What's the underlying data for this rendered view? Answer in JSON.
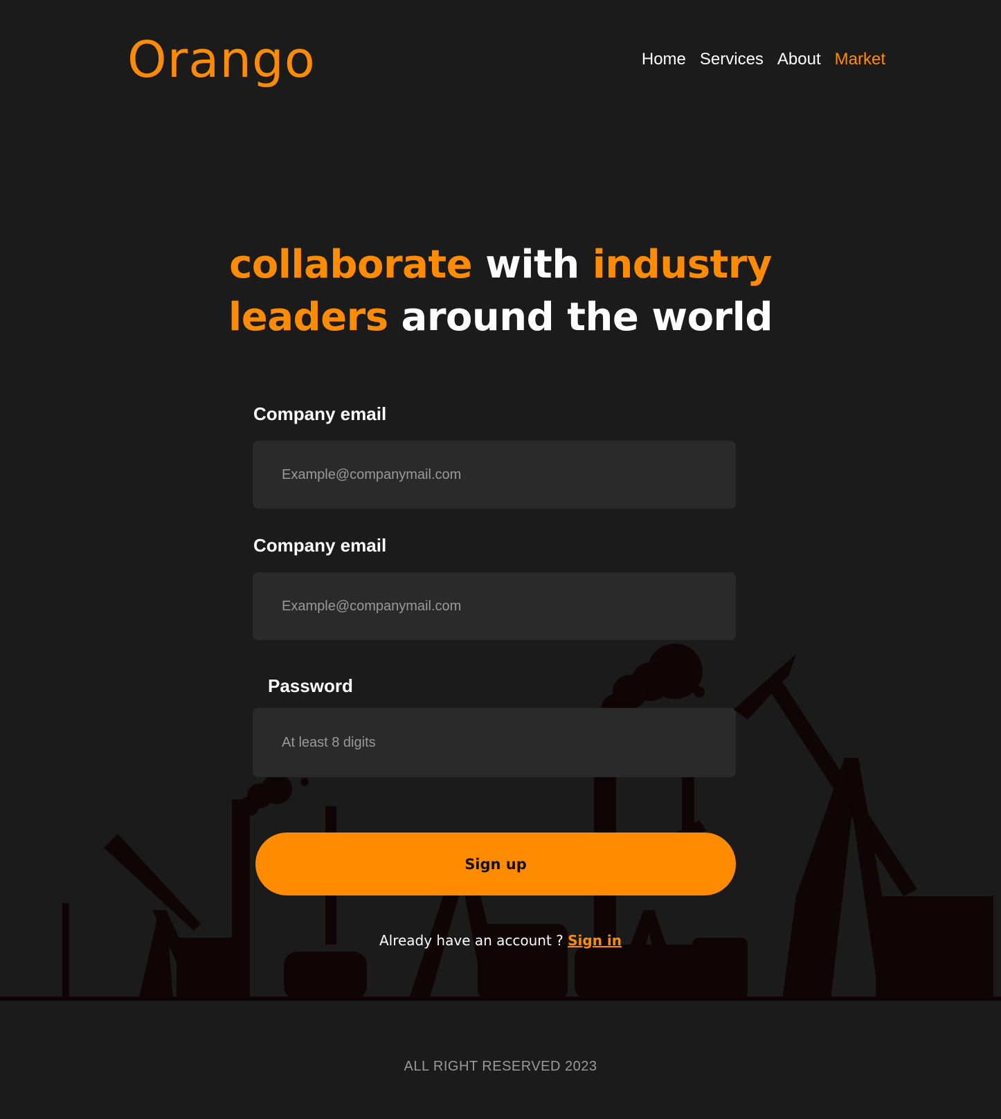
{
  "brand": {
    "logo": "Orango",
    "accent_color": "#ff8c00",
    "background": "#1b1b1b"
  },
  "nav": {
    "items": [
      {
        "label": "Home",
        "active": false
      },
      {
        "label": "Services",
        "active": false
      },
      {
        "label": "About",
        "active": false
      },
      {
        "label": "Market",
        "active": true
      }
    ]
  },
  "hero": {
    "line1_part1": "collaborate",
    "line1_part2": " with ",
    "line1_part3": "industry",
    "line2_part1": "leaders",
    "line2_part2": " around the world"
  },
  "form": {
    "email1": {
      "label": "Company email",
      "placeholder": "Example@companymail.com"
    },
    "email2": {
      "label": "Company email",
      "placeholder": "Example@companymail.com"
    },
    "password": {
      "label": "Password",
      "placeholder": "At least 8 digits"
    },
    "submit_label": "Sign up",
    "signin_prompt": "Already have an account ? ",
    "signin_link": "Sign in"
  },
  "footer": {
    "text": "ALL RIGHT RESERVED 2023"
  },
  "background_art": {
    "subject": "oil-pumpjack-silhouettes"
  }
}
